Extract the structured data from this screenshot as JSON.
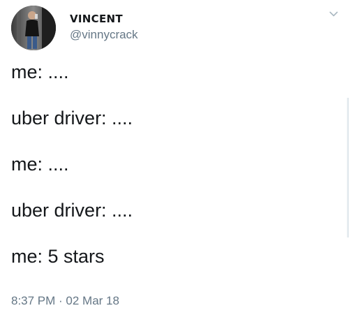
{
  "tweet": {
    "author": {
      "display_name": "VINCENT",
      "handle": "@vinnycrack",
      "avatar_icon": "profile-photo"
    },
    "menu_icon": "chevron-down-icon",
    "lines": [
      "me: ....",
      "uber driver: ....",
      "me: ....",
      "uber driver: ....",
      "me: 5 stars"
    ],
    "timestamp": "8:37 PM · 02 Mar 18"
  },
  "colors": {
    "text": "#14171a",
    "secondary": "#657786",
    "background": "#ffffff"
  }
}
